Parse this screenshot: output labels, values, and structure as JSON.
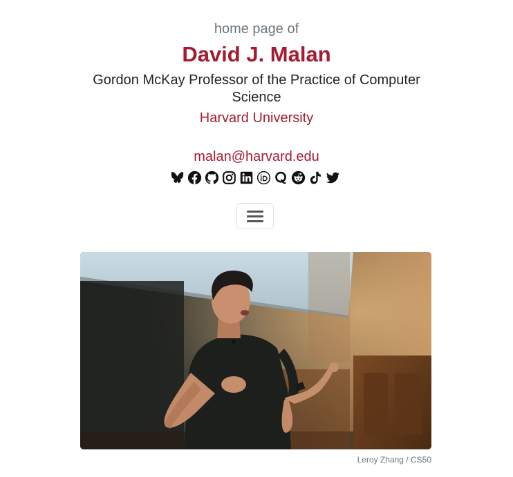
{
  "header": {
    "subtitle": "home page of",
    "name": "David J. Malan",
    "title": "Gordon McKay Professor of the Practice of Computer Science",
    "university": "Harvard University",
    "email": "malan@harvard.edu"
  },
  "social": [
    {
      "icon": "bluesky-icon"
    },
    {
      "icon": "facebook-icon"
    },
    {
      "icon": "github-icon"
    },
    {
      "icon": "instagram-icon"
    },
    {
      "icon": "linkedin-icon"
    },
    {
      "icon": "orcid-icon"
    },
    {
      "icon": "quora-icon"
    },
    {
      "icon": "reddit-icon"
    },
    {
      "icon": "tiktok-icon"
    },
    {
      "icon": "twitter-icon"
    }
  ],
  "menu": {
    "icon": "hamburger-menu-icon"
  },
  "photo": {
    "credit": "Leroy Zhang / CS50"
  },
  "colors": {
    "accent": "#a51c30",
    "muted": "#6c757d",
    "text": "#212529"
  }
}
